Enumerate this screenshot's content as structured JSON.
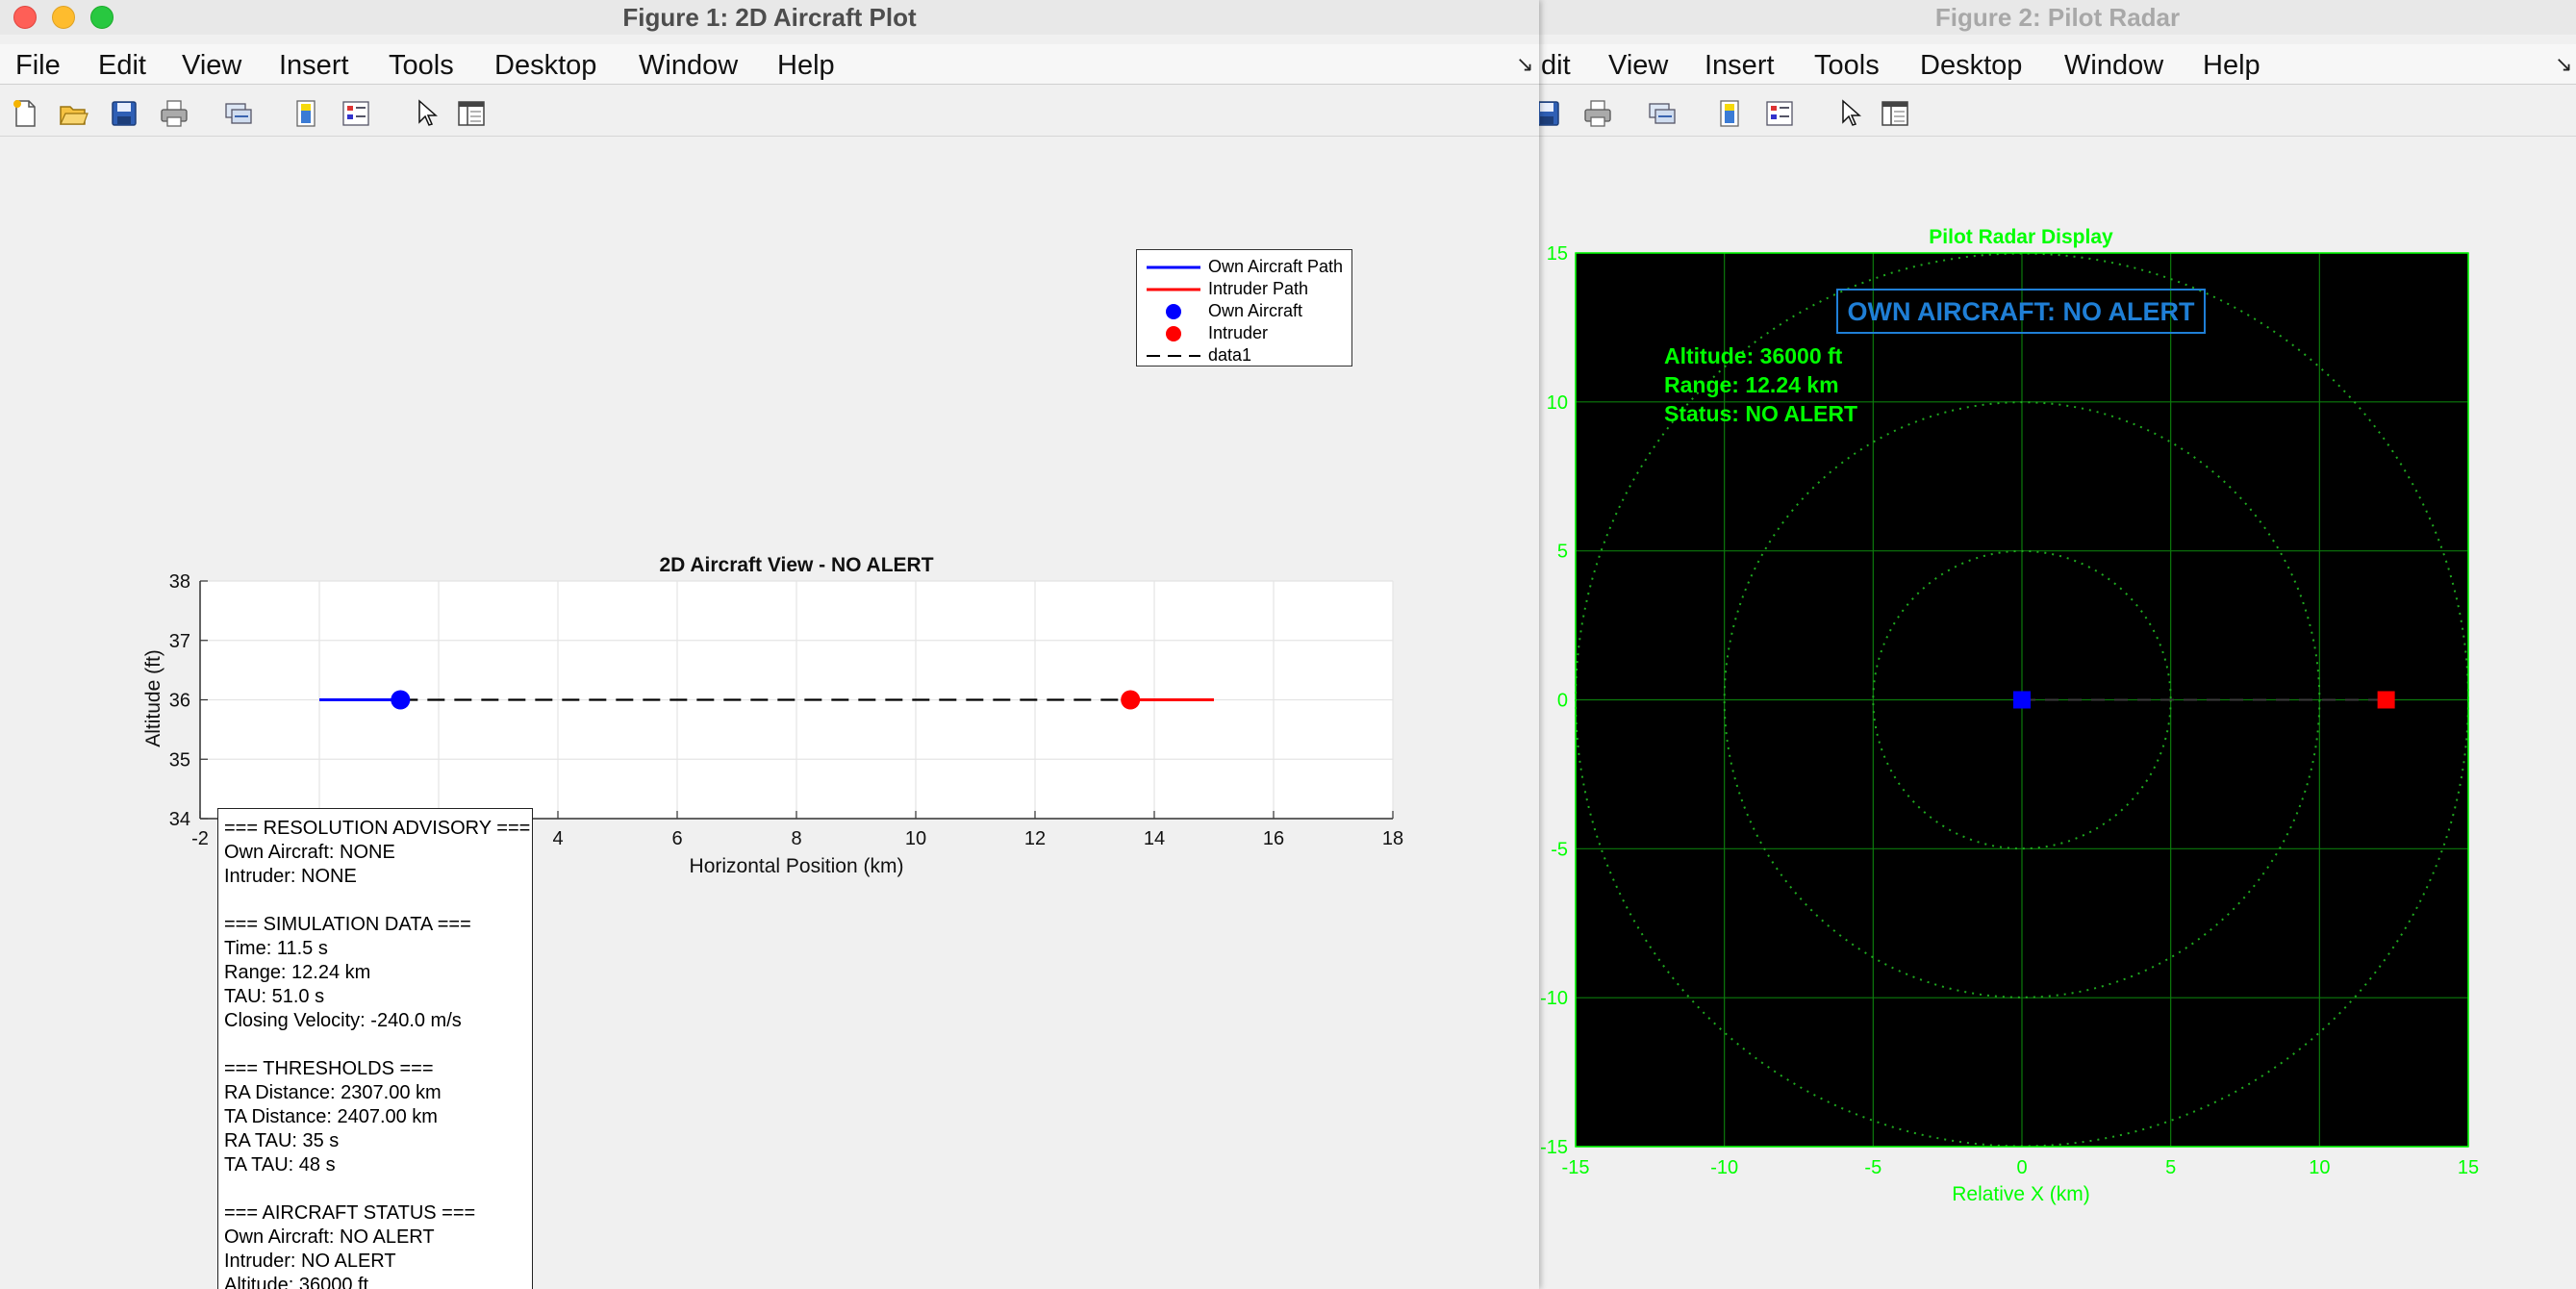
{
  "window1": {
    "title": "Figure 1: 2D Aircraft Plot",
    "menu": [
      "File",
      "Edit",
      "View",
      "Insert",
      "Tools",
      "Desktop",
      "Window",
      "Help"
    ],
    "toolbar_icons": [
      "new-file-icon",
      "open-folder-icon",
      "save-icon",
      "print-icon",
      "link-icon",
      "colorbar-icon",
      "legend-icon",
      "pointer-icon",
      "property-editor-icon"
    ],
    "plot": {
      "title": "2D Aircraft View - NO ALERT",
      "xlabel": "Horizontal Position (km)",
      "ylabel": "Altitude (ft)"
    },
    "legend": [
      "Own Aircraft Path",
      "Intruder Path",
      "Own Aircraft",
      "Intruder",
      "data1"
    ],
    "advisory_text": "=== RESOLUTION ADVISORY ===\nOwn Aircraft: NONE\nIntruder: NONE\n\n=== SIMULATION DATA ===\nTime: 11.5 s\nRange: 12.24 km\nTAU: 51.0 s\nClosing Velocity: -240.0 m/s\n\n=== THRESHOLDS ===\nRA Distance: 2307.00 km\nTA Distance: 2407.00 km\nRA TAU: 35 s\nTA TAU: 48 s\n\n=== AIRCRAFT STATUS ===\nOwn Aircraft: NO ALERT\nIntruder: NO ALERT\nAltitude: 36000 ft"
  },
  "window2": {
    "title": "Figure 2: Pilot Radar",
    "menu": [
      "dit",
      "View",
      "Insert",
      "Tools",
      "Desktop",
      "Window",
      "Help"
    ],
    "radar": {
      "title": "Pilot Radar Display",
      "banner": "OWN AIRCRAFT: NO ALERT",
      "info": [
        "Altitude: 36000 ft",
        "Range: 12.24 km",
        "Status: NO ALERT"
      ],
      "xlabel": "Relative X (km)"
    }
  },
  "colors": {
    "own": "#0000ff",
    "intruder": "#ff0000",
    "radar_green": "#00ff00",
    "radar_banner": "#1f7fd6",
    "radar_bg": "#000000"
  },
  "chart_data": [
    {
      "type": "line",
      "title": "2D Aircraft View - NO ALERT",
      "xlabel": "Horizontal Position (km)",
      "ylabel": "Altitude (ft)",
      "xlim": [
        -2,
        18
      ],
      "ylim": [
        34,
        38
      ],
      "xticks": [
        -2,
        0,
        2,
        4,
        6,
        8,
        10,
        12,
        14,
        16,
        18
      ],
      "yticks": [
        34,
        35,
        36,
        37,
        38
      ],
      "grid": true,
      "legend_position": "top-right",
      "series": [
        {
          "name": "Own Aircraft Path",
          "style": "line",
          "color": "#0000ff",
          "x": [
            0,
            1.36
          ],
          "y": [
            36,
            36
          ]
        },
        {
          "name": "Intruder Path",
          "style": "line",
          "color": "#ff0000",
          "x": [
            13.6,
            15
          ],
          "y": [
            36,
            36
          ]
        },
        {
          "name": "Own Aircraft",
          "style": "marker",
          "color": "#0000ff",
          "x": [
            1.36
          ],
          "y": [
            36
          ]
        },
        {
          "name": "Intruder",
          "style": "marker",
          "color": "#ff0000",
          "x": [
            13.6
          ],
          "y": [
            36
          ]
        },
        {
          "name": "data1",
          "style": "dashed",
          "color": "#000000",
          "x": [
            1.36,
            13.6
          ],
          "y": [
            36,
            36
          ]
        }
      ]
    },
    {
      "type": "scatter",
      "title": "Pilot Radar Display",
      "xlabel": "Relative X (km)",
      "xlim": [
        -15,
        15
      ],
      "ylim": [
        -15,
        15
      ],
      "xticks": [
        -15,
        -10,
        -5,
        0,
        5,
        10,
        15
      ],
      "yticks": [
        -15,
        -10,
        -5,
        0,
        5,
        10,
        15
      ],
      "range_rings": [
        5,
        10,
        15
      ],
      "grid": true,
      "points": [
        {
          "name": "Own Aircraft",
          "x": 0,
          "y": 0,
          "color": "#0000ff"
        },
        {
          "name": "Intruder",
          "x": 12.24,
          "y": 0,
          "color": "#ff0000"
        }
      ]
    }
  ]
}
